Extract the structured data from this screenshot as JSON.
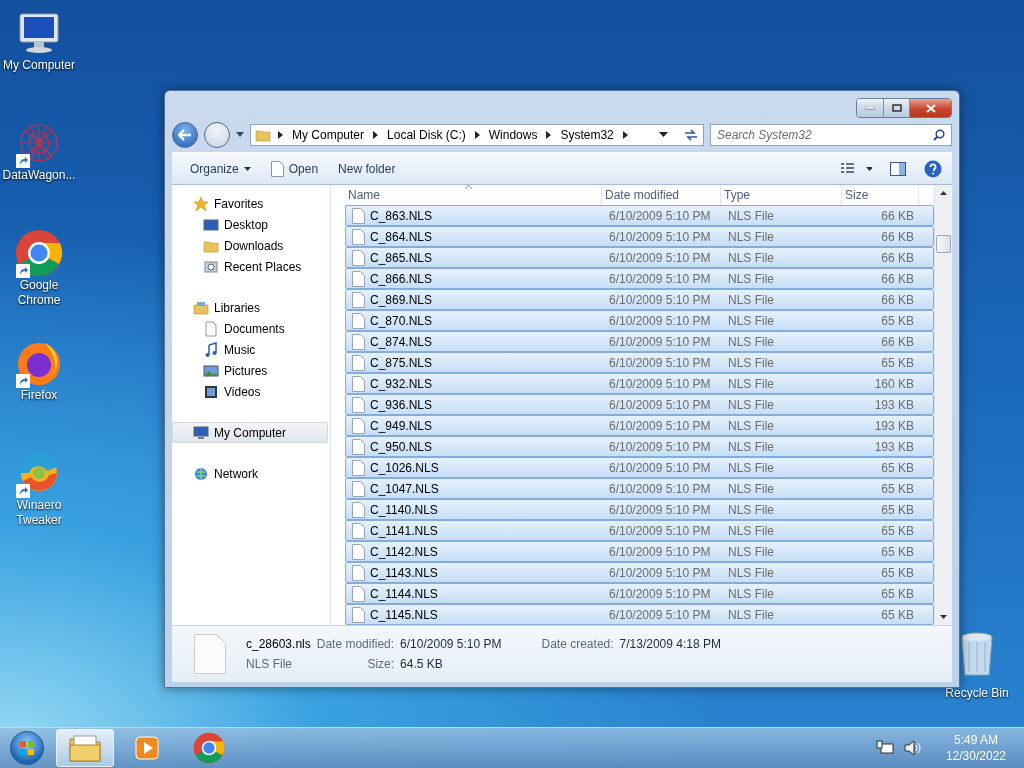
{
  "desktop": {
    "icons": [
      {
        "label": "My Computer",
        "kind": "computer",
        "shortcut": false
      },
      {
        "label": "DataWagon...",
        "kind": "web",
        "shortcut": true
      },
      {
        "label": "Google Chrome",
        "kind": "chrome",
        "shortcut": true
      },
      {
        "label": "Firefox",
        "kind": "firefox",
        "shortcut": true
      },
      {
        "label": "Winaero Tweaker",
        "kind": "winaero",
        "shortcut": true
      }
    ],
    "recycle_bin": {
      "label": "Recycle Bin"
    }
  },
  "window": {
    "breadcrumb": [
      "My Computer",
      "Local Disk (C:)",
      "Windows",
      "System32"
    ],
    "search": {
      "placeholder": "Search System32"
    },
    "toolbar": [
      {
        "label": "Organize",
        "kind": "menu"
      },
      {
        "label": "Open",
        "kind": "open"
      },
      {
        "label": "New folder",
        "kind": "plain"
      }
    ],
    "navigation": [
      {
        "label": "Favorites",
        "kind": "star",
        "selected": false,
        "children": [
          {
            "label": "Desktop",
            "kind": "desktop",
            "selected": false
          },
          {
            "label": "Downloads",
            "kind": "folder",
            "selected": false
          },
          {
            "label": "Recent Places",
            "kind": "recent",
            "selected": false
          }
        ]
      },
      {
        "label": "Libraries",
        "kind": "library",
        "selected": false,
        "children": [
          {
            "label": "Documents",
            "kind": "document",
            "selected": false
          },
          {
            "label": "Music",
            "kind": "music",
            "selected": false
          },
          {
            "label": "Pictures",
            "kind": "picture",
            "selected": false
          },
          {
            "label": "Videos",
            "kind": "video",
            "selected": false
          }
        ]
      },
      {
        "label": "My Computer",
        "kind": "computer",
        "selected": true
      },
      {
        "label": "Network",
        "kind": "network",
        "selected": false
      }
    ],
    "columns": [
      "Name",
      "Date modified",
      "Type",
      "Size"
    ],
    "rows": [
      {
        "name": "C_863.NLS",
        "date": "6/10/2009 5:10 PM",
        "type": "NLS File",
        "size": "66 KB",
        "selected": true
      },
      {
        "name": "C_864.NLS",
        "date": "6/10/2009 5:10 PM",
        "type": "NLS File",
        "size": "66 KB",
        "selected": true
      },
      {
        "name": "C_865.NLS",
        "date": "6/10/2009 5:10 PM",
        "type": "NLS File",
        "size": "66 KB",
        "selected": true
      },
      {
        "name": "C_866.NLS",
        "date": "6/10/2009 5:10 PM",
        "type": "NLS File",
        "size": "66 KB",
        "selected": true
      },
      {
        "name": "C_869.NLS",
        "date": "6/10/2009 5:10 PM",
        "type": "NLS File",
        "size": "66 KB",
        "selected": true
      },
      {
        "name": "C_870.NLS",
        "date": "6/10/2009 5:10 PM",
        "type": "NLS File",
        "size": "65 KB",
        "selected": true
      },
      {
        "name": "C_874.NLS",
        "date": "6/10/2009 5:10 PM",
        "type": "NLS File",
        "size": "66 KB",
        "selected": true
      },
      {
        "name": "C_875.NLS",
        "date": "6/10/2009 5:10 PM",
        "type": "NLS File",
        "size": "65 KB",
        "selected": true
      },
      {
        "name": "C_932.NLS",
        "date": "6/10/2009 5:10 PM",
        "type": "NLS File",
        "size": "160 KB",
        "selected": true
      },
      {
        "name": "C_936.NLS",
        "date": "6/10/2009 5:10 PM",
        "type": "NLS File",
        "size": "193 KB",
        "selected": true
      },
      {
        "name": "C_949.NLS",
        "date": "6/10/2009 5:10 PM",
        "type": "NLS File",
        "size": "193 KB",
        "selected": true
      },
      {
        "name": "C_950.NLS",
        "date": "6/10/2009 5:10 PM",
        "type": "NLS File",
        "size": "193 KB",
        "selected": true
      },
      {
        "name": "C_1026.NLS",
        "date": "6/10/2009 5:10 PM",
        "type": "NLS File",
        "size": "65 KB",
        "selected": true
      },
      {
        "name": "C_1047.NLS",
        "date": "6/10/2009 5:10 PM",
        "type": "NLS File",
        "size": "65 KB",
        "selected": true
      },
      {
        "name": "C_1140.NLS",
        "date": "6/10/2009 5:10 PM",
        "type": "NLS File",
        "size": "65 KB",
        "selected": true
      },
      {
        "name": "C_1141.NLS",
        "date": "6/10/2009 5:10 PM",
        "type": "NLS File",
        "size": "65 KB",
        "selected": true
      },
      {
        "name": "C_1142.NLS",
        "date": "6/10/2009 5:10 PM",
        "type": "NLS File",
        "size": "65 KB",
        "selected": true
      },
      {
        "name": "C_1143.NLS",
        "date": "6/10/2009 5:10 PM",
        "type": "NLS File",
        "size": "65 KB",
        "selected": true
      },
      {
        "name": "C_1144.NLS",
        "date": "6/10/2009 5:10 PM",
        "type": "NLS File",
        "size": "65 KB",
        "selected": true
      },
      {
        "name": "C_1145.NLS",
        "date": "6/10/2009 5:10 PM",
        "type": "NLS File",
        "size": "65 KB",
        "selected": true
      }
    ],
    "details": {
      "name": "c_28603.nls",
      "type": "NLS File",
      "fields": [
        {
          "label": "Date modified:",
          "value": "6/10/2009 5:10 PM"
        },
        {
          "label": "Size:",
          "value": "64.5 KB"
        },
        {
          "label": "Date created:",
          "value": "7/13/2009 4:18 PM"
        }
      ]
    }
  },
  "taskbar": {
    "items": [
      {
        "kind": "explorer",
        "selected": true
      },
      {
        "kind": "media",
        "selected": false
      },
      {
        "kind": "chrome",
        "selected": false
      }
    ],
    "time": "5:49 AM",
    "date": "12/30/2022"
  }
}
